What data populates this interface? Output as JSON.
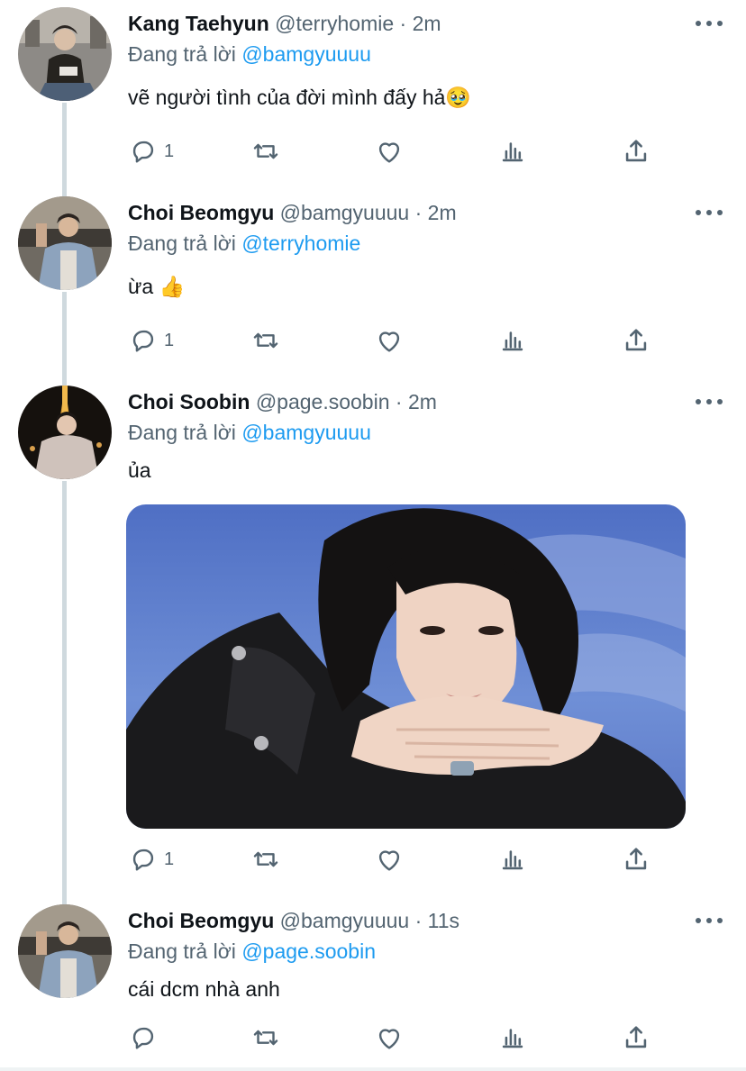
{
  "colors": {
    "link": "#1d9bf0",
    "meta": "#536471",
    "text": "#0f1419"
  },
  "replying_prefix": "Đang trả lời",
  "tweets": [
    {
      "name": "Kang Taehyun",
      "handle": "@terryhomie",
      "time": "· 2m",
      "reply_to": "@bamgyuuuu",
      "text": "vẽ người tình của đời mình đấy hả🥹",
      "reply_count": "1"
    },
    {
      "name": "Choi Beomgyu",
      "handle": "@bamgyuuuu",
      "time": "· 2m",
      "reply_to": "@terryhomie",
      "text": "ừa 👍",
      "reply_count": "1"
    },
    {
      "name": "Choi Soobin",
      "handle": "@page.soobin",
      "time": "· 2m",
      "reply_to": "@bamgyuuuu",
      "text": "ủa",
      "reply_count": "1",
      "has_media": true
    },
    {
      "name": "Choi Beomgyu",
      "handle": "@bamgyuuuu",
      "time": "· 11s",
      "reply_to": "@page.soobin",
      "text": "cái dcm nhà anh",
      "reply_count": ""
    }
  ],
  "icons": [
    "reply-icon",
    "retweet-icon",
    "like-icon",
    "views-icon",
    "share-icon",
    "more-icon"
  ]
}
